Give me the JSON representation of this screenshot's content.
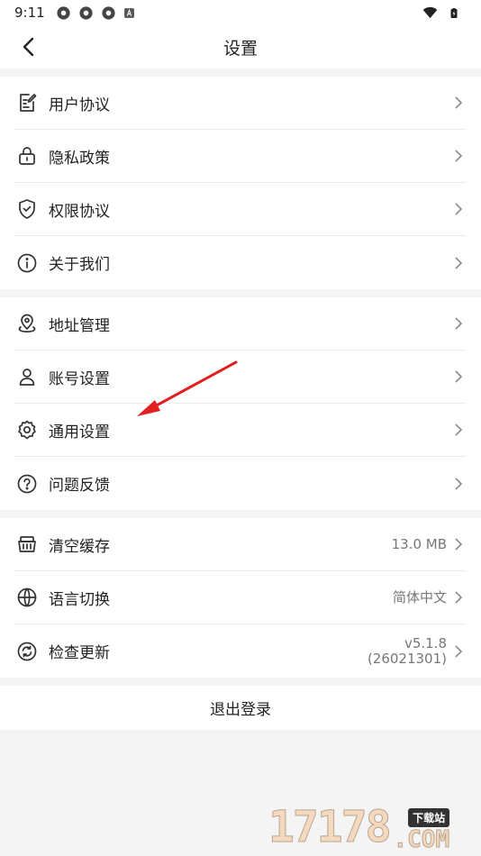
{
  "status_bar": {
    "time": "9:11",
    "notification_icons": [
      "app-icon",
      "app-icon",
      "app-icon",
      "a-icon"
    ],
    "right_icons": [
      "wifi-icon",
      "battery-icon"
    ]
  },
  "header": {
    "title": "设置"
  },
  "groups": [
    {
      "items": [
        {
          "name": "user-agreement",
          "icon": "document-edit-icon",
          "label": "用户协议"
        },
        {
          "name": "privacy-policy",
          "icon": "lock-icon",
          "label": "隐私政策"
        },
        {
          "name": "permission-agreement",
          "icon": "shield-check-icon",
          "label": "权限协议"
        },
        {
          "name": "about-us",
          "icon": "info-icon",
          "label": "关于我们"
        }
      ]
    },
    {
      "items": [
        {
          "name": "address-management",
          "icon": "location-pin-icon",
          "label": "地址管理"
        },
        {
          "name": "account-settings",
          "icon": "user-icon",
          "label": "账号设置"
        },
        {
          "name": "general-settings",
          "icon": "gear-icon",
          "label": "通用设置"
        },
        {
          "name": "feedback",
          "icon": "question-icon",
          "label": "问题反馈"
        }
      ]
    },
    {
      "items": [
        {
          "name": "clear-cache",
          "icon": "basket-icon",
          "label": "清空缓存",
          "value": "13.0 MB"
        },
        {
          "name": "language",
          "icon": "globe-icon",
          "label": "语言切换",
          "value": "简体中文"
        },
        {
          "name": "check-update",
          "icon": "refresh-icon",
          "label": "检查更新",
          "value_line1": "v5.1.8",
          "value_line2": "(26021301)"
        }
      ]
    }
  ],
  "logout_label": "退出登录",
  "annotation": {
    "color": "#e02020"
  },
  "watermark": {
    "number": "17178",
    "tag": "下载站",
    "suffix": ".COM"
  },
  "colors": {
    "background": "#f4f4f4",
    "card": "#ffffff",
    "text": "#222222",
    "secondary_text": "#777777"
  }
}
